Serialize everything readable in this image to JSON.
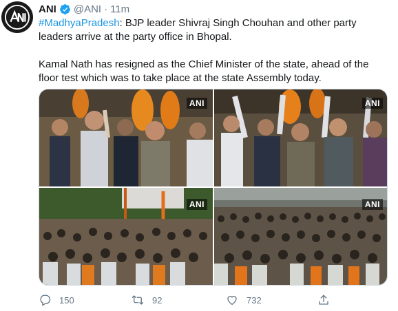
{
  "tweet": {
    "author_name": "ANI",
    "handle": "@ANI",
    "separator": "·",
    "time": "11m",
    "hashtag": "#MadhyaPradesh",
    "text_line1": ": BJP leader Shivraj Singh Chouhan and other party leaders arrive at the party office in Bhopal.",
    "text_line2": "Kamal Nath has resigned as the Chief Minister of the state, ahead of the floor test which was to take place at the state Assembly today."
  },
  "media": {
    "photos": [
      {
        "watermark": "ANI"
      },
      {
        "watermark": "ANI"
      },
      {
        "watermark": "ANI"
      },
      {
        "watermark": "ANI"
      }
    ]
  },
  "actions": {
    "replies": "150",
    "retweets": "92",
    "likes": "732"
  },
  "colors": {
    "link": "#1b95e0",
    "muted": "#657786",
    "text": "#14171a",
    "verified": "#1da1f2"
  },
  "icons": [
    "ani-logo",
    "verified-badge-icon",
    "reply-icon",
    "retweet-icon",
    "like-icon",
    "share-icon"
  ]
}
